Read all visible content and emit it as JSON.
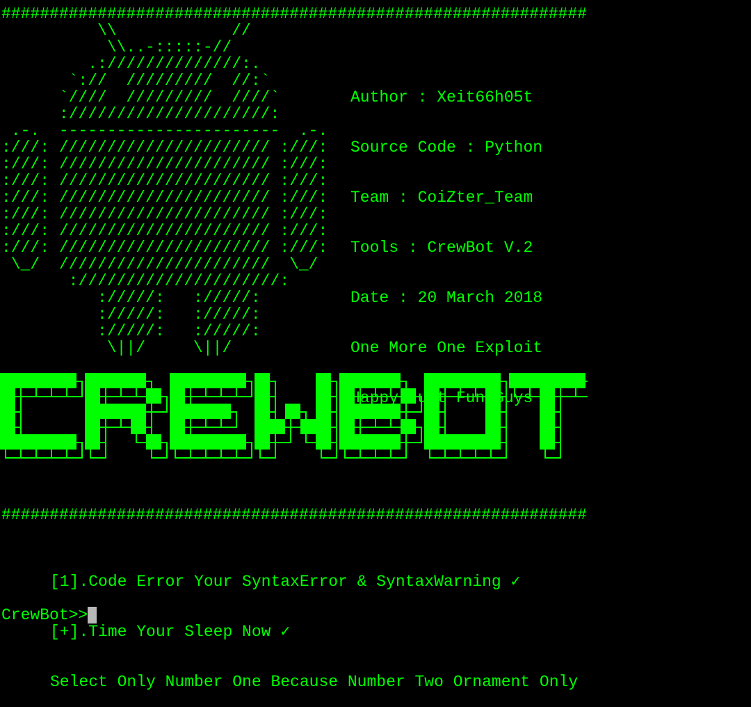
{
  "separator_top": "#############################################################",
  "android_art": [
    "          \\\\            //",
    "           \\\\..-:::::-//",
    "         .://////////////:.",
    "       `://  /////////  //:`",
    "      `////  /////////  ////`",
    "      ://///////////////////:",
    " .-.  -----------------------  .-.",
    ":///: ////////////////////// :///:",
    ":///: ////////////////////// :///:",
    ":///: ////////////////////// :///:",
    ":///: ////////////////////// :///:",
    ":///: ////////////////////// :///:",
    ":///: ////////////////////// :///:",
    ":///: ////////////////////// :///:",
    " \\_/  //////////////////////  \\_/",
    "       ://///////////////////:",
    "          ://///:   ://///:",
    "          ://///:   ://///:",
    "          ://///:   ://///:",
    "           \\||/     \\||/"
  ],
  "info": {
    "author": "Author : Xeit66h05t",
    "source_code": "Source Code : Python",
    "team": "Team : CoiZter_Team",
    "tools": "Tools : CrewBot V.2",
    "date": "Date : 20 March 2018",
    "slogan": "One More One Exploit",
    "greeting": "Happy Just Fun Guys"
  },
  "banner_text": "CREWBOT",
  "separator_bottom": "#############################################################",
  "menu": {
    "option1": "[1].Code Error Your SyntaxError & SyntaxWarning ✓",
    "option2": "[+].Time Your Sleep Now ✓",
    "note": "Select Only Number One Because Number Two Ornament Only"
  },
  "prompt": "CrewBot>>",
  "colors": {
    "background": "#000000",
    "foreground": "#00ff00",
    "cursor": "#b8b8b8"
  }
}
